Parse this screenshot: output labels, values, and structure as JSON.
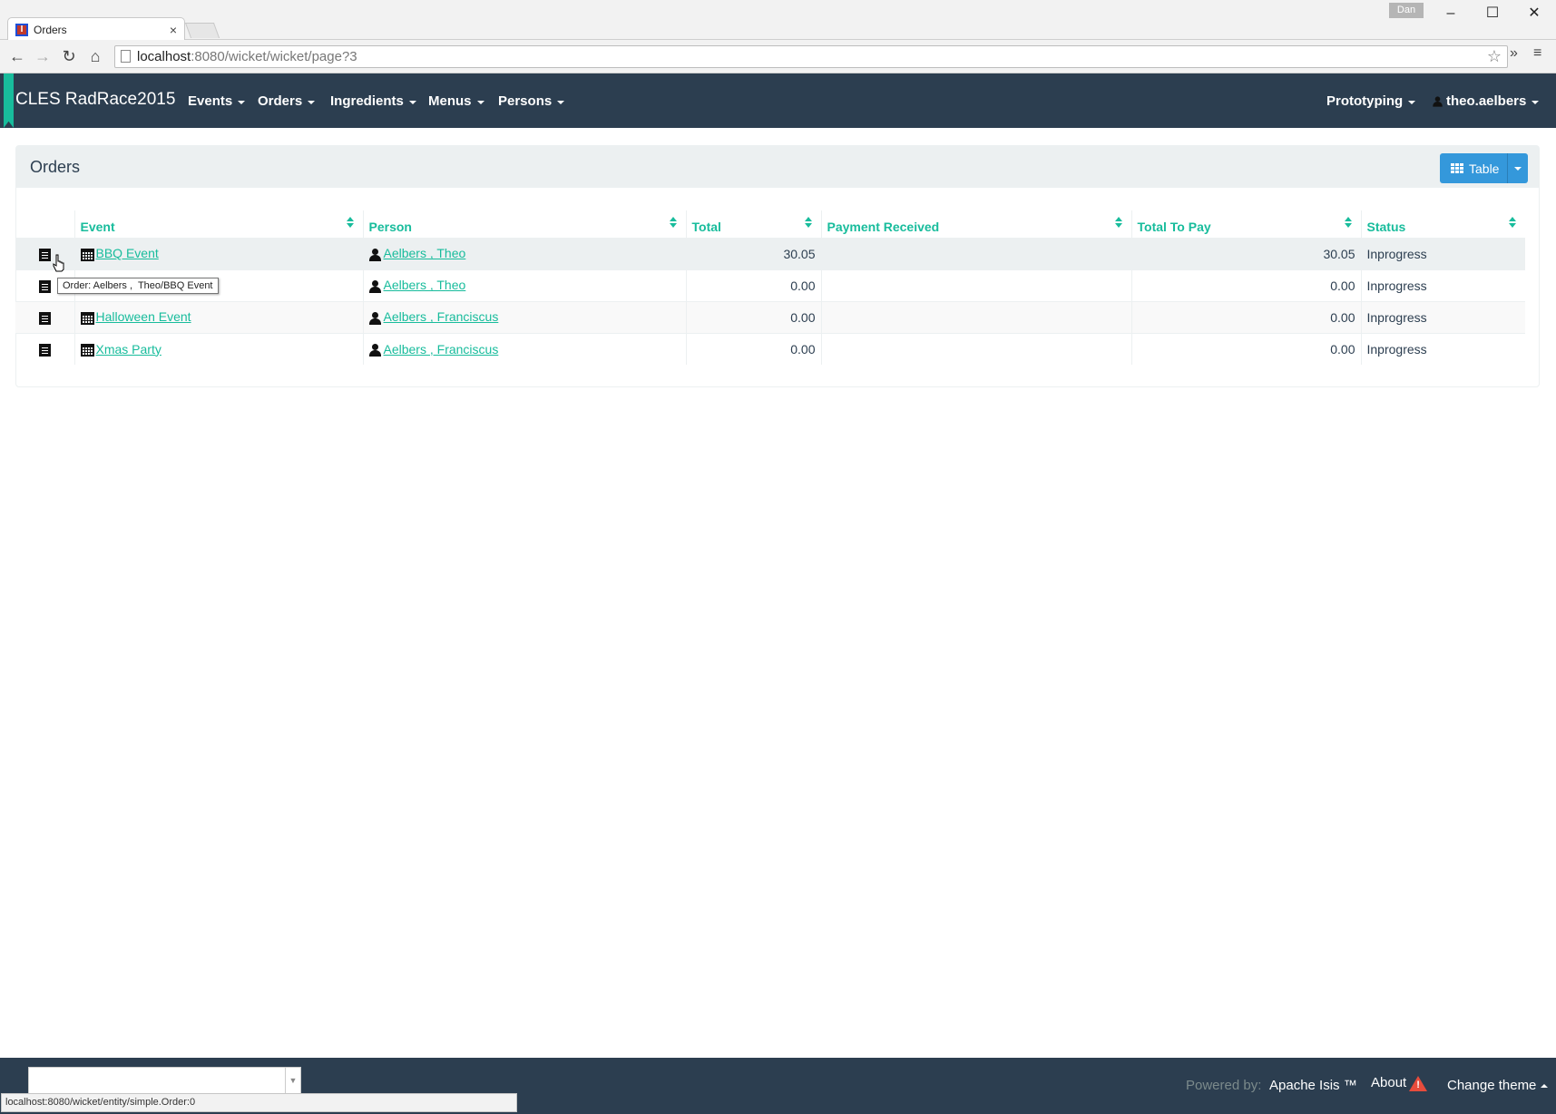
{
  "browser": {
    "tab_title": "Orders",
    "tab_close": "×",
    "user_badge": "Dan",
    "address_host": "localhost",
    "address_path": ":8080/wicket/wicket/page?3",
    "status_url": "localhost:8080/wicket/entity/simple.Order:0"
  },
  "navbar": {
    "brand": "CLES RadRace2015",
    "menus": [
      "Events",
      "Orders",
      "Ingredients",
      "Menus",
      "Persons"
    ],
    "prototyping": "Prototyping",
    "user": "theo.aelbers"
  },
  "panel": {
    "title": "Orders",
    "view_button": "Table"
  },
  "table": {
    "columns": [
      "Event",
      "Person",
      "Total",
      "Payment Received",
      "Total To Pay",
      "Status"
    ],
    "rows": [
      {
        "event": "BBQ Event",
        "person": "Aelbers , Theo",
        "total": "30.05",
        "payment_received": "",
        "total_to_pay": "30.05",
        "status": "Inprogress"
      },
      {
        "event": "",
        "person": "Aelbers , Theo",
        "total": "0.00",
        "payment_received": "",
        "total_to_pay": "0.00",
        "status": "Inprogress"
      },
      {
        "event": "Halloween Event",
        "person": "Aelbers , Franciscus",
        "total": "0.00",
        "payment_received": "",
        "total_to_pay": "0.00",
        "status": "Inprogress"
      },
      {
        "event": "Xmas Party",
        "person": "Aelbers , Franciscus",
        "total": "0.00",
        "payment_received": "",
        "total_to_pay": "0.00",
        "status": "Inprogress"
      }
    ]
  },
  "tooltip": "Order: Aelbers ,  Theo/BBQ Event",
  "footer": {
    "powered_by": "Powered by:",
    "apache_isis": "Apache Isis ™",
    "about": "About",
    "change_theme": "Change theme"
  },
  "colors": {
    "navbar": "#2c3e50",
    "accent": "#18bc9c",
    "button": "#3498db"
  }
}
